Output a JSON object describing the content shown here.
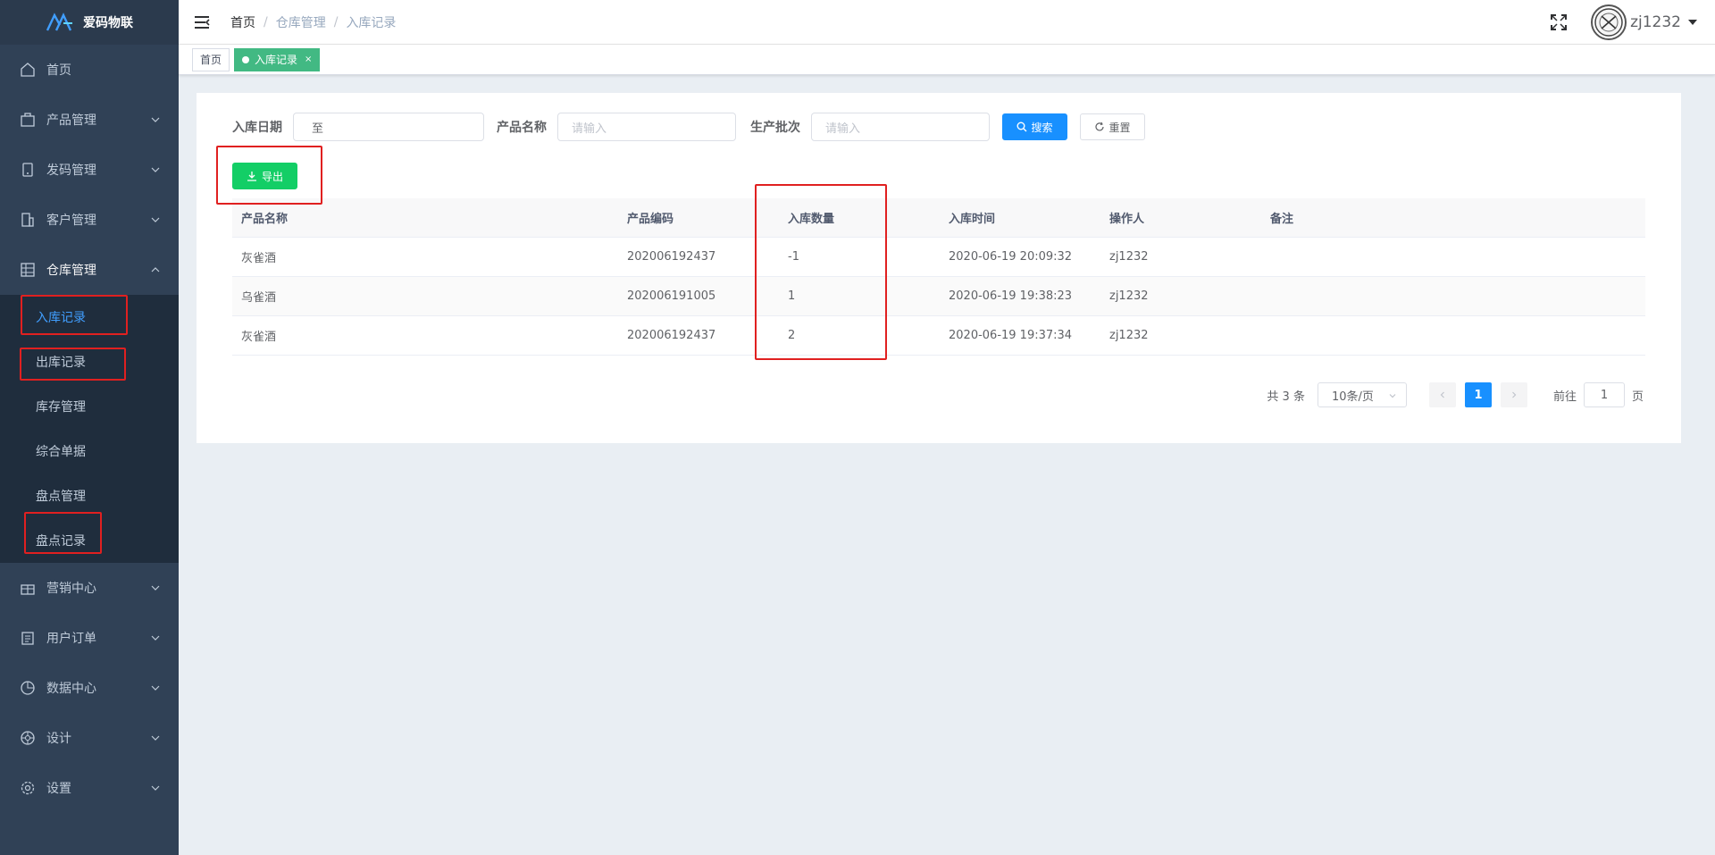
{
  "app": {
    "title": "爱码物联"
  },
  "sidebar": {
    "items": [
      {
        "label": "首页",
        "icon": "home-icon"
      },
      {
        "label": "产品管理",
        "icon": "product-icon"
      },
      {
        "label": "发码管理",
        "icon": "code-icon"
      },
      {
        "label": "客户管理",
        "icon": "customer-icon"
      },
      {
        "label": "仓库管理",
        "icon": "warehouse-icon"
      },
      {
        "label": "营销中心",
        "icon": "gift-icon"
      },
      {
        "label": "用户订单",
        "icon": "order-icon"
      },
      {
        "label": "数据中心",
        "icon": "chart-icon"
      },
      {
        "label": "设计",
        "icon": "design-icon"
      },
      {
        "label": "设置",
        "icon": "settings-icon"
      }
    ],
    "warehouse_sub": [
      "入库记录",
      "出库记录",
      "库存管理",
      "综合单据",
      "盘点管理",
      "盘点记录"
    ]
  },
  "breadcrumb": [
    "首页",
    "仓库管理",
    "入库记录"
  ],
  "user": {
    "name": "zj1232"
  },
  "tags": {
    "home": "首页",
    "active": "入库记录",
    "close": "×"
  },
  "filters": {
    "date_label": "入库日期",
    "date_sep": "至",
    "product_label": "产品名称",
    "product_placeholder": "请输入",
    "batch_label": "生产批次",
    "batch_placeholder": "请输入",
    "search_btn": "搜索",
    "reset_btn": "重置",
    "export_btn": "导出"
  },
  "table": {
    "columns": [
      "产品名称",
      "产品编码",
      "入库数量",
      "入库时间",
      "操作人",
      "备注"
    ],
    "rows": [
      [
        "灰雀酒",
        "202006192437",
        "-1",
        "2020-06-19 20:09:32",
        "zj1232",
        ""
      ],
      [
        "乌雀酒",
        "202006191005",
        "1",
        "2020-06-19 19:38:23",
        "zj1232",
        ""
      ],
      [
        "灰雀酒",
        "202006192437",
        "2",
        "2020-06-19 19:37:34",
        "zj1232",
        ""
      ]
    ]
  },
  "pagination": {
    "total": "共 3 条",
    "page_size": "10条/页",
    "current": "1",
    "goto_label": "前往",
    "goto_value": "1",
    "page_suffix": "页"
  },
  "colors": {
    "sidebar_bg": "#304156",
    "submenu_bg": "#1f2d3d",
    "active_link": "#409eff",
    "primary": "#1890ff",
    "success": "#13ce66",
    "tag_active": "#42b983",
    "annotation": "#e02020"
  }
}
